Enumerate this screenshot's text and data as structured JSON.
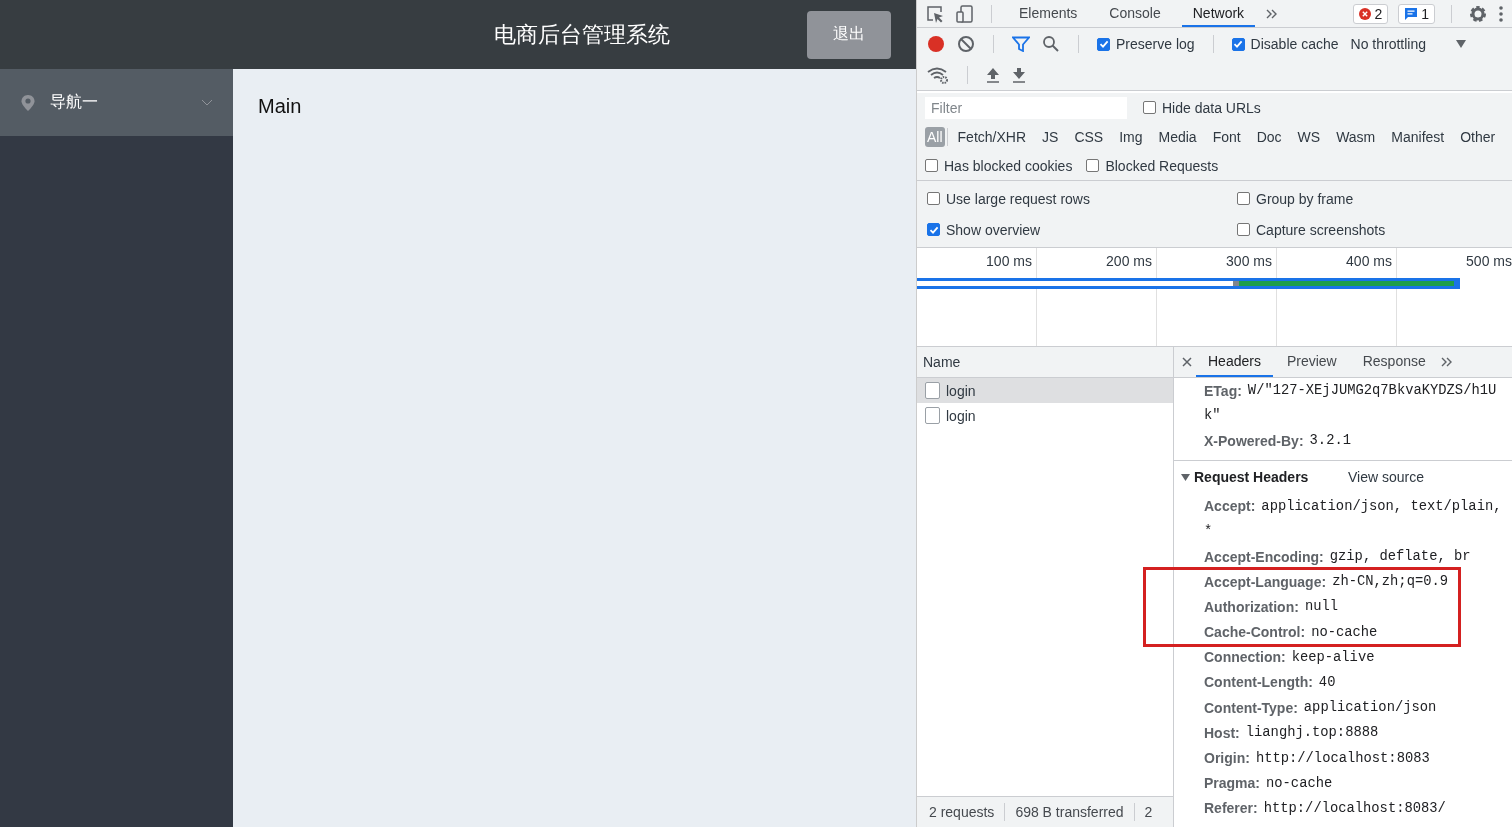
{
  "app": {
    "title": "电商后台管理系统",
    "logout_button": "退出",
    "sidebar": {
      "items": [
        {
          "label": "导航一",
          "expanded": false
        }
      ]
    },
    "main": {
      "text": "Main"
    }
  },
  "devtools": {
    "tabs": [
      {
        "label": "Elements",
        "selected": false
      },
      {
        "label": "Console",
        "selected": false
      },
      {
        "label": "Network",
        "selected": true
      }
    ],
    "error_count": "2",
    "message_count": "1",
    "toolbar": {
      "preserve_log": {
        "label": "Preserve log",
        "checked": true
      },
      "disable_cache": {
        "label": "Disable cache",
        "checked": true
      },
      "throttling": "No throttling"
    },
    "filter": {
      "placeholder": "Filter",
      "hide_data_urls": {
        "label": "Hide data URLs",
        "checked": false
      }
    },
    "types": [
      {
        "label": "All",
        "selected": true
      },
      {
        "label": "Fetch/XHR",
        "selected": false
      },
      {
        "label": "JS",
        "selected": false
      },
      {
        "label": "CSS",
        "selected": false
      },
      {
        "label": "Img",
        "selected": false
      },
      {
        "label": "Media",
        "selected": false
      },
      {
        "label": "Font",
        "selected": false
      },
      {
        "label": "Doc",
        "selected": false
      },
      {
        "label": "WS",
        "selected": false
      },
      {
        "label": "Wasm",
        "selected": false
      },
      {
        "label": "Manifest",
        "selected": false
      },
      {
        "label": "Other",
        "selected": false
      }
    ],
    "blocked_options": [
      {
        "label": "Has blocked cookies",
        "checked": false
      },
      {
        "label": "Blocked Requests",
        "checked": false
      }
    ],
    "settings": [
      {
        "label": "Use large request rows",
        "checked": false
      },
      {
        "label": "Group by frame",
        "checked": false
      },
      {
        "label": "Show overview",
        "checked": true
      },
      {
        "label": "Capture screenshots",
        "checked": false
      }
    ],
    "overview_ticks": [
      "100 ms",
      "200 ms",
      "300 ms",
      "400 ms",
      "500 ms"
    ],
    "requests": {
      "column": "Name",
      "rows": [
        {
          "name": "login",
          "selected": true
        },
        {
          "name": "login",
          "selected": false
        }
      ]
    },
    "status_bar": [
      "2 requests",
      "698 B transferred",
      "2"
    ],
    "details": {
      "tabs": [
        {
          "label": "Headers",
          "selected": true
        },
        {
          "label": "Preview",
          "selected": false
        },
        {
          "label": "Response",
          "selected": false
        }
      ],
      "response_headers": [
        {
          "name": "ETag:",
          "value": "W/\"127-XEjJUMG2q7BkvaKYDZS/h1U",
          "continuation": "k\""
        },
        {
          "name": "X-Powered-By:",
          "value": "3.2.1"
        }
      ],
      "request_headers": {
        "title": "Request Headers",
        "expanded": true,
        "view_source": "View source",
        "rows": [
          {
            "name": "Accept:",
            "value": "application/json, text/plain,",
            "continuation": "*"
          },
          {
            "name": "Accept-Encoding:",
            "value": "gzip, deflate, br"
          },
          {
            "name": "Accept-Language:",
            "value": "zh-CN,zh;q=0.9"
          },
          {
            "name": "Authorization:",
            "value": "null"
          },
          {
            "name": "Cache-Control:",
            "value": "no-cache"
          },
          {
            "name": "Connection:",
            "value": "keep-alive"
          },
          {
            "name": "Content-Length:",
            "value": "40"
          },
          {
            "name": "Content-Type:",
            "value": "application/json"
          },
          {
            "name": "Host:",
            "value": "lianghj.top:8888"
          },
          {
            "name": "Origin:",
            "value": "http://localhost:8083"
          },
          {
            "name": "Pragma:",
            "value": "no-cache"
          },
          {
            "name": "Referer:",
            "value": "http://localhost:8083/"
          }
        ]
      }
    }
  }
}
